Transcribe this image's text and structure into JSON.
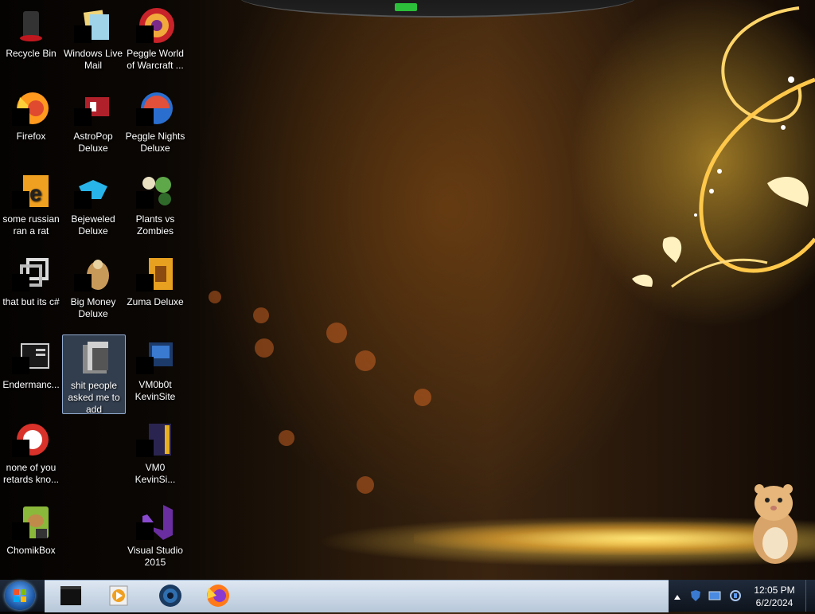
{
  "desktop": {
    "icons": [
      {
        "id": "recycle-bin",
        "label": "Recycle Bin"
      },
      {
        "id": "windows-live-mail",
        "label": "Windows Live Mail"
      },
      {
        "id": "peggle-world",
        "label": "Peggle World of Warcraft ..."
      },
      {
        "id": "firefox",
        "label": "Firefox"
      },
      {
        "id": "astropop",
        "label": "AstroPop Deluxe"
      },
      {
        "id": "peggle-nights",
        "label": "Peggle Nights Deluxe"
      },
      {
        "id": "some-russian",
        "label": "some russian ran a rat"
      },
      {
        "id": "bejeweled",
        "label": "Bejeweled Deluxe"
      },
      {
        "id": "plants-vs-zombies",
        "label": "Plants vs Zombies"
      },
      {
        "id": "that-but-its-c",
        "label": "that but its c#"
      },
      {
        "id": "big-money",
        "label": "Big Money Deluxe"
      },
      {
        "id": "zuma",
        "label": "Zuma Deluxe"
      },
      {
        "id": "endermanch",
        "label": "Endermanc..."
      },
      {
        "id": "shit-people",
        "label": "shit people asked me to add"
      },
      {
        "id": "vm0b0t",
        "label": "VM0b0t KevinSite"
      },
      {
        "id": "none-of-you",
        "label": "none of you retards kno..."
      },
      {
        "id": "vm0-kevinsite",
        "label": "VM0 KevinSi..."
      },
      {
        "id": "chomikbox",
        "label": "ChomikBox"
      },
      {
        "id": "visual-studio",
        "label": "Visual Studio 2015"
      }
    ]
  },
  "taskbar": {
    "pinned": [
      "terminal-icon",
      "media-player-icon",
      "browser-globe-icon",
      "firefox-icon"
    ],
    "clock": {
      "time": "12:05 PM",
      "date": "6/2/2024"
    }
  },
  "colors": {
    "accent": "#1e5aa8",
    "selection": "#82aadc"
  }
}
